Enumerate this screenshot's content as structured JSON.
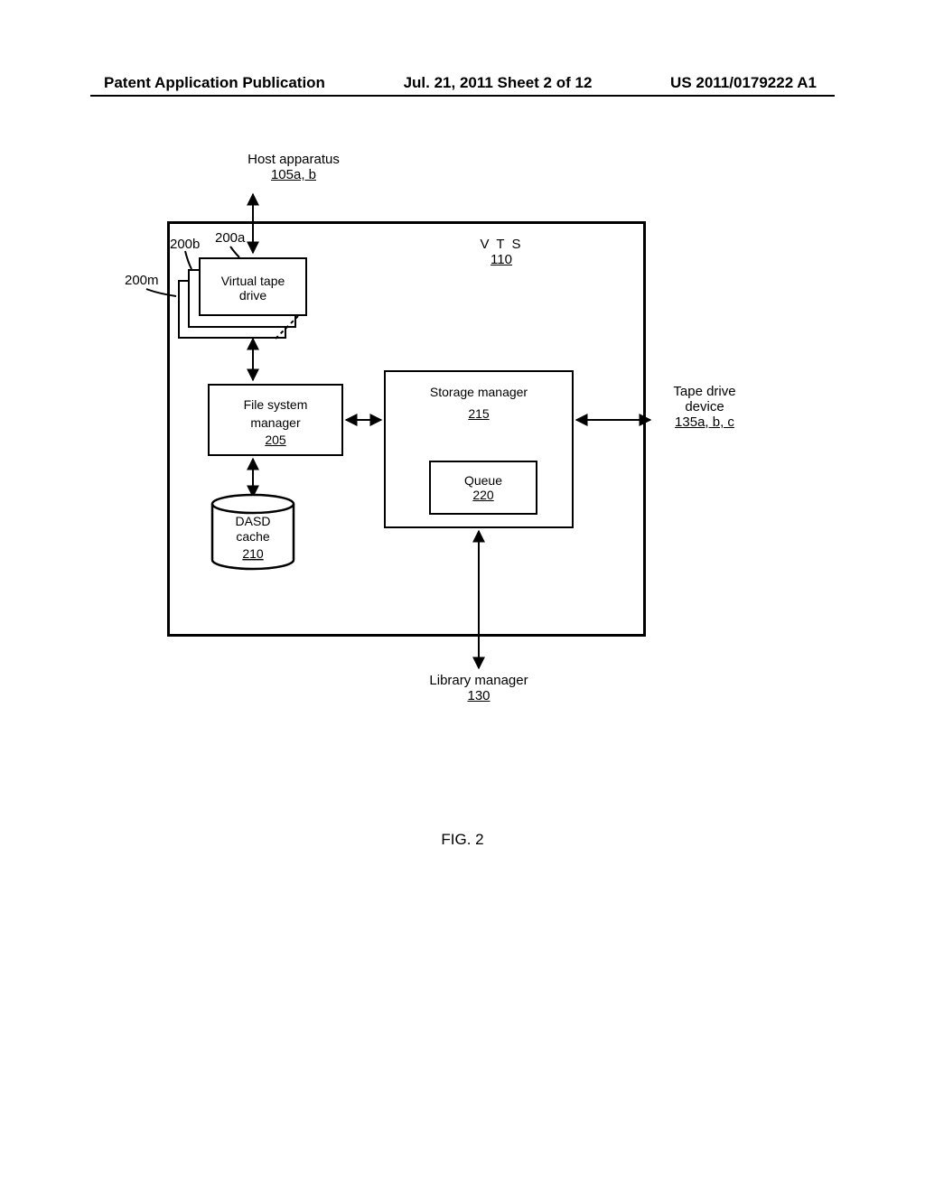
{
  "header": {
    "left": "Patent Application Publication",
    "mid": "Jul. 21, 2011  Sheet 2 of 12",
    "right": "US 2011/0179222 A1"
  },
  "labels": {
    "host_apparatus": "Host apparatus",
    "host_ref": "105a, b",
    "vts": "V T S",
    "vts_ref": "110",
    "vtd_200a": "200a",
    "vtd_200b": "200b",
    "vtd_200m": "200m",
    "vtd_text": "Virtual tape drive",
    "vtd_text_1": "Virtual tape",
    "vtd_text_2": "drive",
    "fs_manager": "File system manager",
    "fs_manager_1": "File system",
    "fs_manager_2": "manager",
    "fs_ref": "205",
    "storage_manager": "Storage manager",
    "storage_ref": "215",
    "queue": "Queue",
    "queue_ref": "220",
    "dasd_1": "DASD",
    "dasd_2": "cache",
    "dasd_ref": "210",
    "tape_drive_1": "Tape drive",
    "tape_drive_2": "device",
    "tape_ref": "135a, b, c",
    "library_mgr": "Library manager",
    "library_ref": "130",
    "figure": "FIG. 2"
  }
}
